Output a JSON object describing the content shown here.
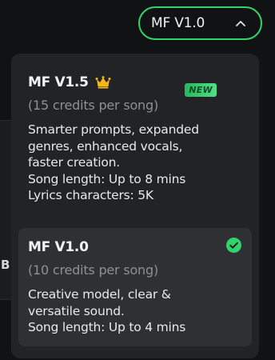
{
  "trigger": {
    "label": "MF V1.0",
    "icon": "chevron-up-icon"
  },
  "background": {
    "partial_label": "B"
  },
  "dropdown": {
    "options": [
      {
        "name": "MF V1.5",
        "icon": "crown-icon",
        "badge": "NEW",
        "credits": "(15 credits per song)",
        "description_lines": [
          "Smarter prompts, expanded",
          "genres, enhanced vocals,",
          "faster creation."
        ],
        "song_length": "Song length: Up to 8 mins",
        "lyrics_characters": "Lyrics characters: 5K",
        "selected": false
      },
      {
        "name": "MF V1.0",
        "icon": "check-circle-icon",
        "credits": "(10 credits per song)",
        "description_lines": [
          "Creative model, clear &",
          "versatile sound."
        ],
        "song_length": "Song length: Up to 4 mins",
        "selected": true
      }
    ]
  },
  "colors": {
    "accent_green": "#31d46a",
    "crown_gold": "#f5b81c",
    "dropdown_bg": "#222327",
    "selected_bg": "#2f3034",
    "page_bg": "#111214"
  }
}
